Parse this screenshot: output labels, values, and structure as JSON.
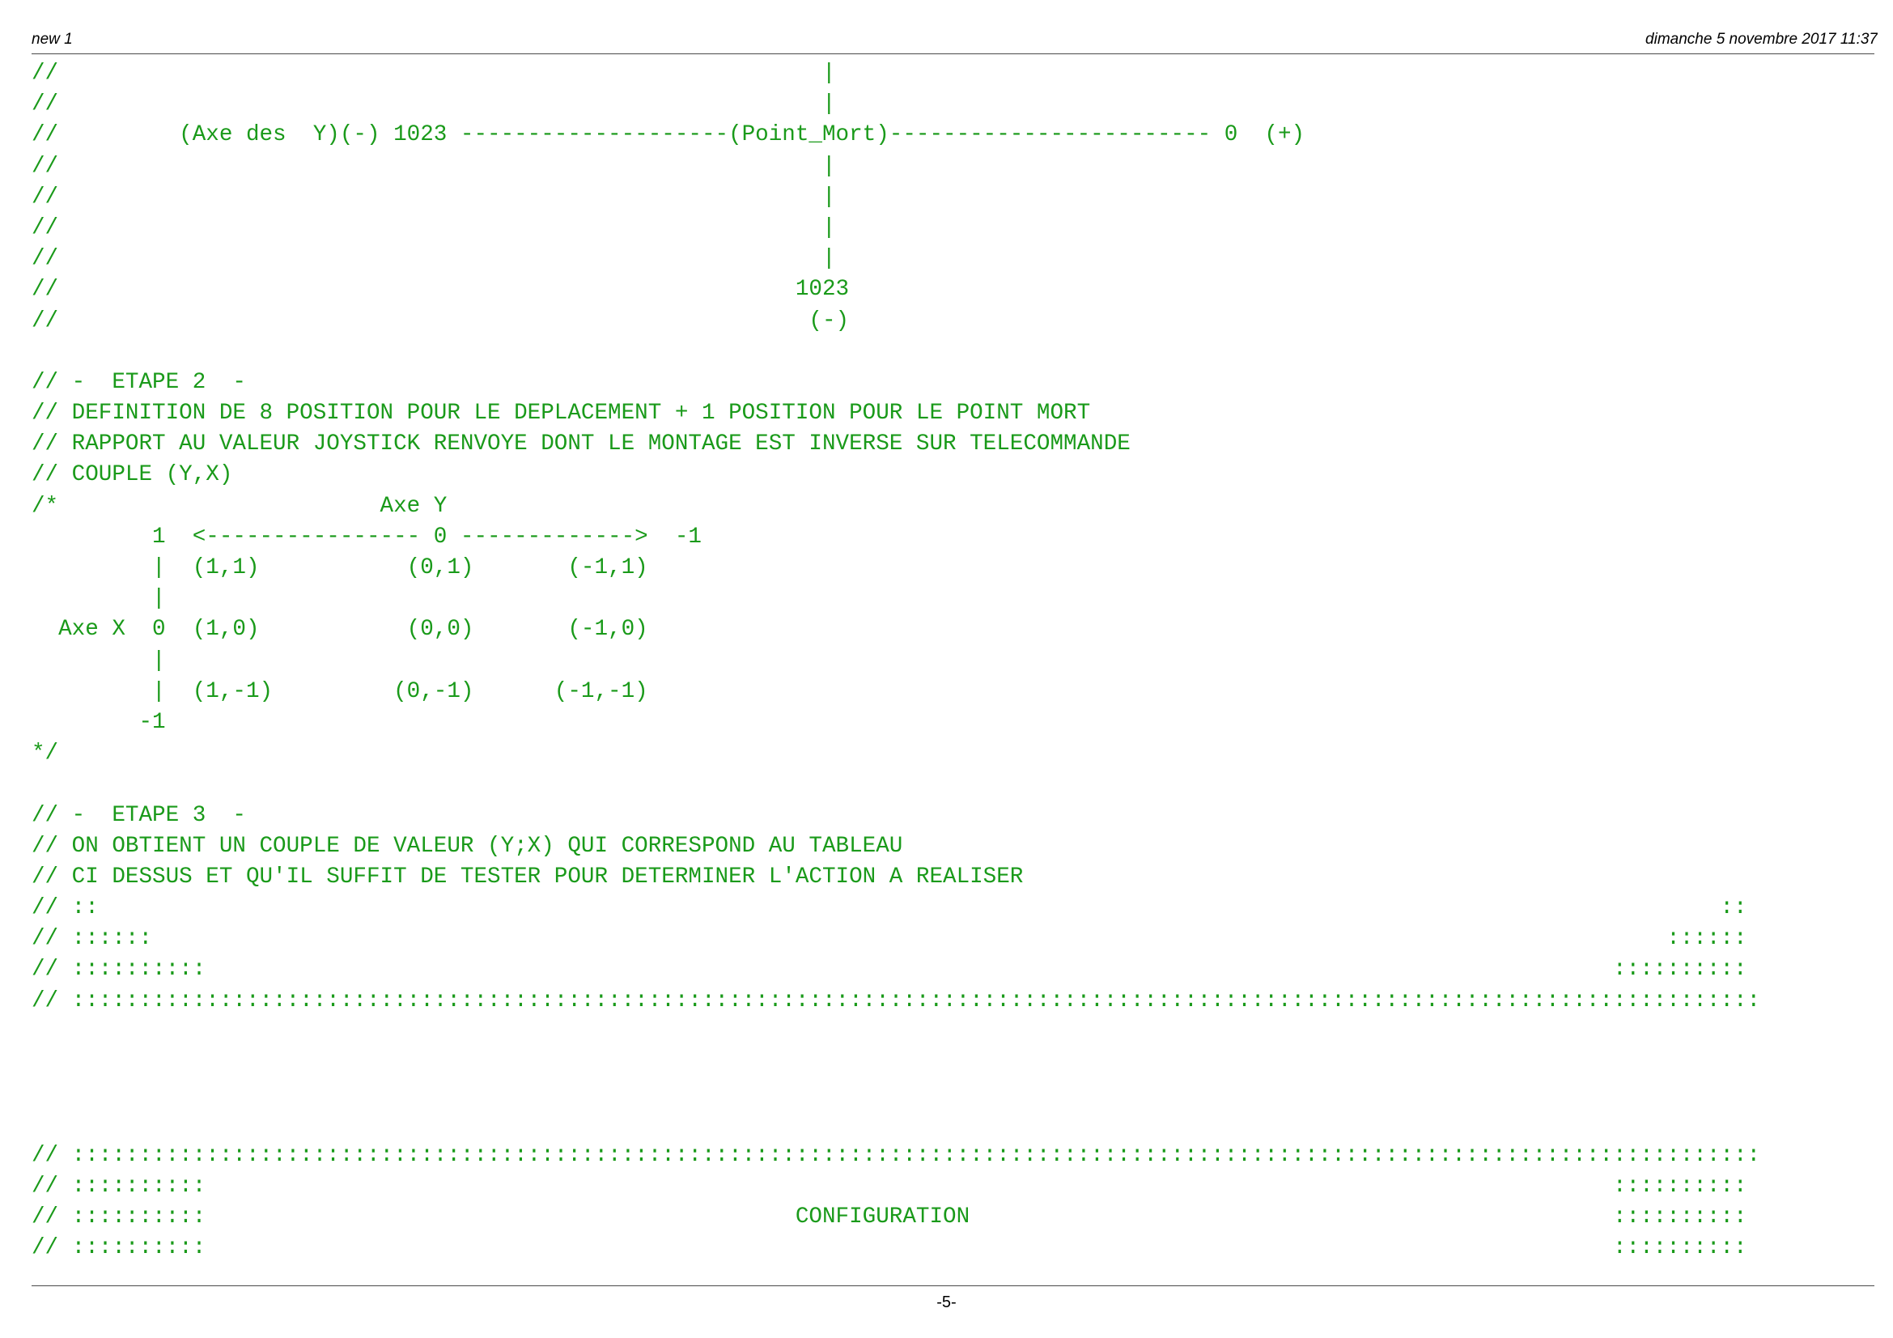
{
  "header": {
    "title": "new 1",
    "datetime": "dimanche 5 novembre 2017 11:37"
  },
  "code_lines": [
    "//                                                         |",
    "//                                                         |",
    "//         (Axe des  Y)(-) 1023 --------------------(Point_Mort)------------------------ 0  (+)",
    "//                                                         |",
    "//                                                         |",
    "//                                                         |",
    "//                                                         |",
    "//                                                       1023",
    "//                                                        (-)",
    "",
    "// -  ETAPE 2  -",
    "// DEFINITION DE 8 POSITION POUR LE DEPLACEMENT + 1 POSITION POUR LE POINT MORT",
    "// RAPPORT AU VALEUR JOYSTICK RENVOYE DONT LE MONTAGE EST INVERSE SUR TELECOMMANDE",
    "// COUPLE (Y,X)",
    "/*                        Axe Y",
    "         1  <---------------- 0 ------------->  -1",
    "         |  (1,1)           (0,1)       (-1,1)",
    "         |",
    "  Axe X  0  (1,0)           (0,0)       (-1,0)",
    "         |",
    "         |  (1,-1)         (0,-1)      (-1,-1)",
    "        -1",
    "*/",
    "",
    "// -  ETAPE 3  -",
    "// ON OBTIENT UN COUPLE DE VALEUR (Y;X) QUI CORRESPOND AU TABLEAU",
    "// CI DESSUS ET QU'IL SUFFIT DE TESTER POUR DETERMINER L'ACTION A REALISER",
    "// ::                                                                                                                         ::",
    "// ::::::                                                                                                                 ::::::",
    "// ::::::::::                                                                                                         ::::::::::",
    "// ::::::::::::::::::::::::::::::::::::::::::::::::::::::::::::::::::::::::::::::::::::::::::::::::::::::::::::::::::::::::::::::",
    "",
    "",
    "",
    "",
    "// ::::::::::::::::::::::::::::::::::::::::::::::::::::::::::::::::::::::::::::::::::::::::::::::::::::::::::::::::::::::::::::::",
    "// ::::::::::                                                                                                         ::::::::::",
    "// ::::::::::                                            CONFIGURATION                                                ::::::::::",
    "// ::::::::::                                                                                                         ::::::::::"
  ],
  "footer": {
    "page_number": "-5-"
  }
}
